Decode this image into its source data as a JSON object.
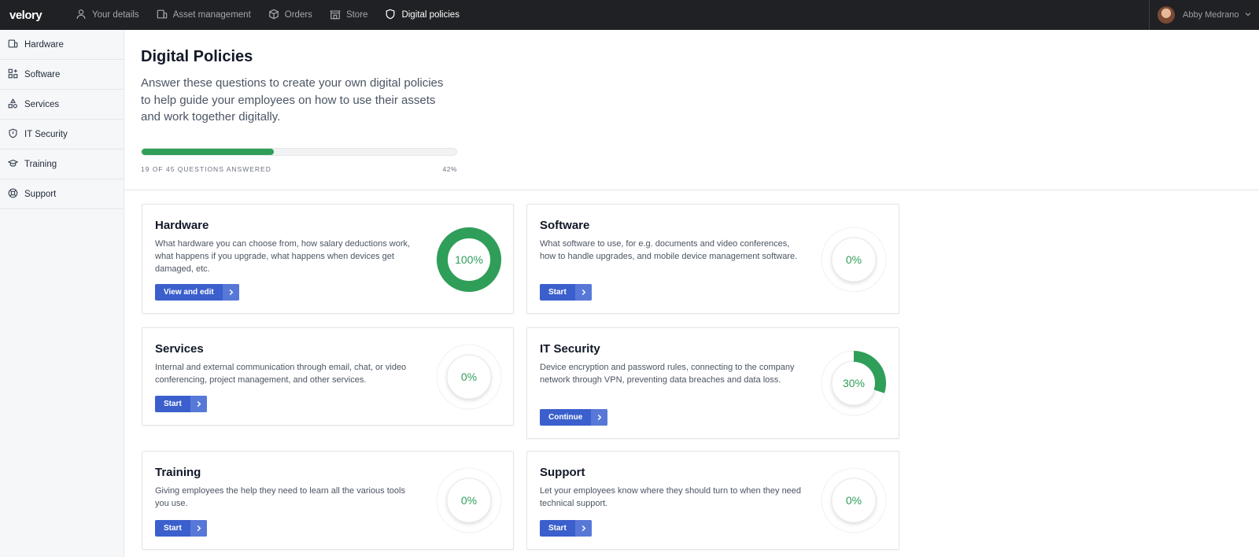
{
  "brand": "velory",
  "nav": [
    {
      "label": "Your details",
      "icon": "user-icon"
    },
    {
      "label": "Asset management",
      "icon": "devices-icon"
    },
    {
      "label": "Orders",
      "icon": "box-icon"
    },
    {
      "label": "Store",
      "icon": "store-icon"
    },
    {
      "label": "Digital policies",
      "icon": "shield-icon",
      "active": true
    }
  ],
  "user": {
    "name": "Abby Medrano"
  },
  "sidebar": [
    {
      "label": "Hardware",
      "icon": "devices-icon"
    },
    {
      "label": "Software",
      "icon": "apps-icon"
    },
    {
      "label": "Services",
      "icon": "services-icon"
    },
    {
      "label": "IT Security",
      "icon": "shield-icon"
    },
    {
      "label": "Training",
      "icon": "graduation-cap-icon"
    },
    {
      "label": "Support",
      "icon": "lifebuoy-icon"
    }
  ],
  "header": {
    "title": "Digital Policies",
    "subtitle": "Answer these questions to create your own digital policies to help guide your employees on how to use their assets and work together digitally.",
    "progress_label": "19 OF 45 QUESTIONS ANSWERED",
    "progress_pct_label": "42%",
    "progress_value": 0.42
  },
  "cards": [
    {
      "title": "Hardware",
      "desc": "What hardware you can choose from, how salary deductions work, what happens if you upgrade, what happens when devices get damaged, etc.",
      "button": "View and edit",
      "pct_label": "100%",
      "pct": 1.0
    },
    {
      "title": "Software",
      "desc": "What software to use, for e.g. documents and video conferences, how to handle upgrades, and mobile device management software.",
      "button": "Start",
      "pct_label": "0%",
      "pct": 0
    },
    {
      "title": "Services",
      "desc": "Internal and external communication through email, chat, or video conferencing, project management, and other services.",
      "button": "Start",
      "pct_label": "0%",
      "pct": 0
    },
    {
      "title": "IT Security",
      "desc": "Device encryption and password rules, connecting to the company network through VPN, preventing data breaches and data loss.",
      "button": "Continue",
      "pct_label": "30%",
      "pct": 0.3
    },
    {
      "title": "Training",
      "desc": "Giving employees the help they need to learn all the various tools you use.",
      "button": "Start",
      "pct_label": "0%",
      "pct": 0
    },
    {
      "title": "Support",
      "desc": "Let your employees know where they should turn to when they need technical support.",
      "button": "Start",
      "pct_label": "0%",
      "pct": 0
    }
  ],
  "colors": {
    "accent_green": "#2f9e58",
    "button_blue": "#3b5fcc",
    "topbar": "#1f2124"
  }
}
